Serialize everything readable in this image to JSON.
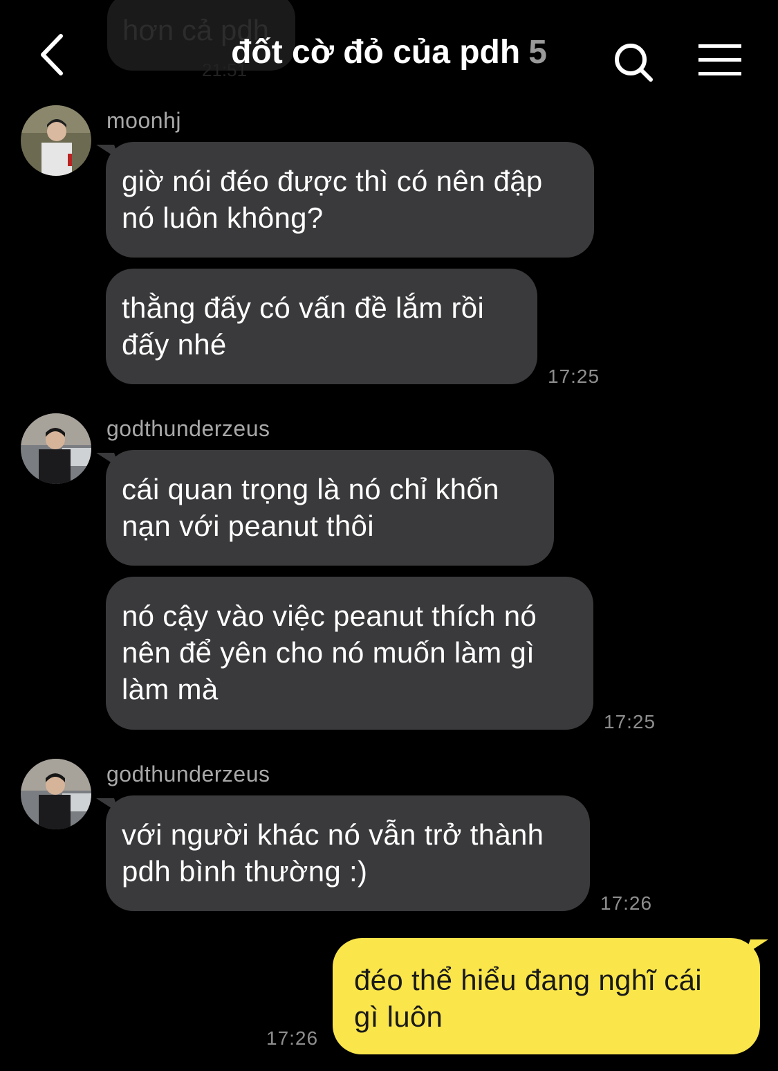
{
  "header": {
    "title": "đốt cờ đỏ của pdh",
    "member_count": "5",
    "back_icon": "chevron-left-icon",
    "search_icon": "search-icon",
    "menu_icon": "hamburger-menu-icon"
  },
  "previous": {
    "text": "hơn cả pdh",
    "time": "21:51"
  },
  "messages": [
    {
      "sender": "moonhj",
      "bubbles": [
        "giờ nói đéo được thì có nên đập\nnó luôn không?",
        "thằng đấy có vấn đề lắm rồi\nđấy nhé"
      ],
      "time": "17:25"
    },
    {
      "sender": "godthunderzeus",
      "bubbles": [
        "cái quan trọng là nó chỉ khốn\nnạn với peanut thôi",
        "nó cậy vào việc peanut thích nó\nnên để yên cho nó muốn làm gì\nlàm mà"
      ],
      "time": "17:25"
    },
    {
      "sender": "godthunderzeus",
      "bubbles": [
        "với người khác nó vẫn trở thành\npdh bình thường :)"
      ],
      "time": "17:26"
    }
  ],
  "my_message": {
    "text": "đéo thể hiểu đang nghĩ cái\ngì luôn",
    "time": "17:26"
  },
  "colors": {
    "background": "#000000",
    "bubble_other": "#3a3a3c",
    "bubble_mine": "#fae64b",
    "timestamp": "#8e8e8e",
    "sender_name": "#a8a8a8"
  }
}
